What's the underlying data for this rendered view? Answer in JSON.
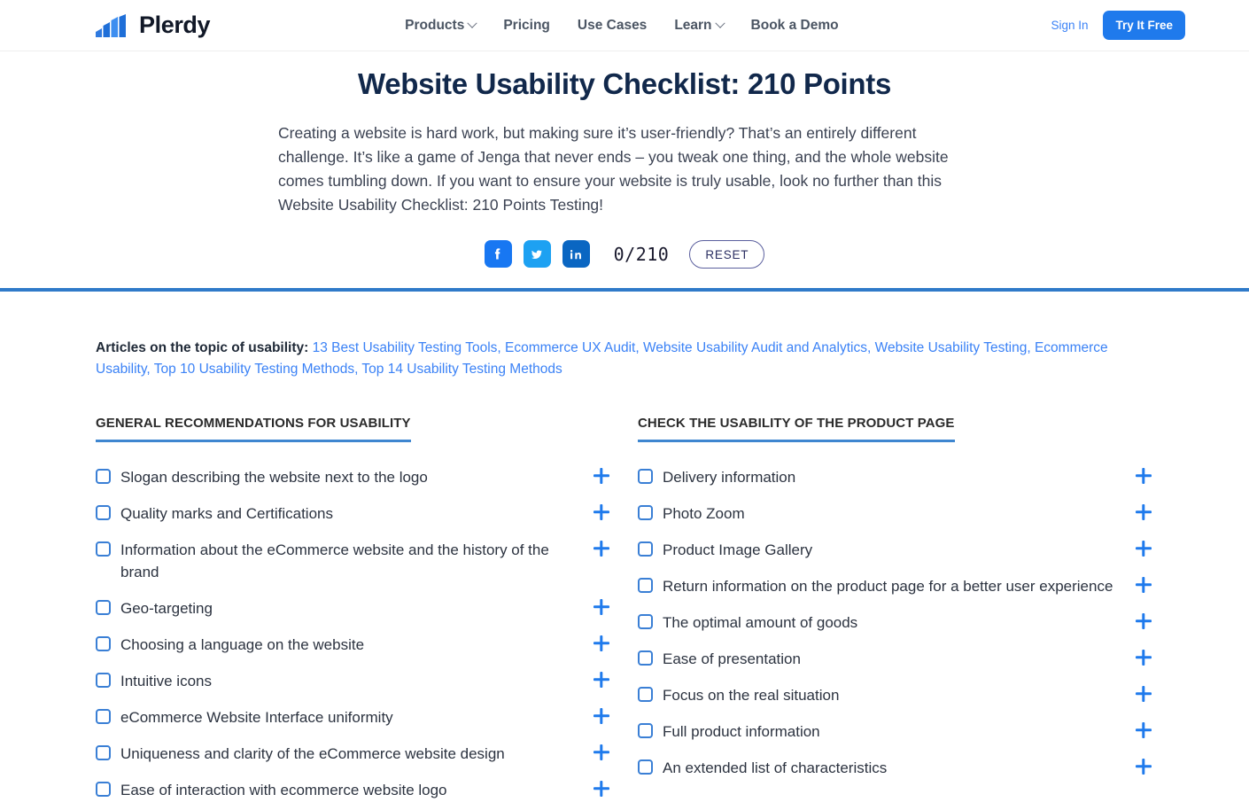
{
  "header": {
    "logo_word": "Plerdy",
    "logo_mark_icon": "bar-chart-logo-icon",
    "flag_icon": "ukraine-flag-icon",
    "nav": [
      {
        "label": "Products",
        "has_caret": true
      },
      {
        "label": "Pricing",
        "has_caret": false
      },
      {
        "label": "Use Cases",
        "has_caret": false
      },
      {
        "label": "Learn",
        "has_caret": true
      },
      {
        "label": "Book a Demo",
        "has_caret": false
      }
    ],
    "sign_in": "Sign In",
    "try_free": "Try It Free",
    "accent_color": "#1f7aec"
  },
  "hero": {
    "title": "Website Usability Checklist: 210 Points",
    "description": "Creating a website is hard work, but making sure it’s user-friendly? That’s an entirely different challenge. It’s like a game of Jenga that never ends – you tweak one thing, and the whole website comes tumbling down. If you want to ensure your website is truly usable, look no further than this Website Usability Checklist: 210 Points Testing!",
    "share": [
      {
        "name": "facebook-share-button",
        "icon": "facebook-icon",
        "color": "#1877F2"
      },
      {
        "name": "twitter-share-button",
        "icon": "twitter-icon",
        "color": "#1DA1F2"
      },
      {
        "name": "linkedin-share-button",
        "icon": "linkedin-icon",
        "color": "#0A66C2"
      }
    ],
    "counter": "0/210",
    "reset_label": "RESET",
    "divider_color": "#2f7ac9"
  },
  "articles": {
    "label": "Articles on the topic of usability:",
    "links": [
      "13 Best Usability Testing Tools",
      "Ecommerce UX Audit",
      "Website Usability Audit and Analytics",
      "Website Usability Testing",
      "Ecommerce Usability",
      "Top 10 Usability Testing Methods",
      "Top 14 Usability Testing Methods"
    ]
  },
  "columns": [
    {
      "title": "GENERAL RECOMMENDATIONS FOR USABILITY",
      "items": [
        "Slogan describing the website next to the logo",
        "Quality marks and Certifications",
        "Information about the eCommerce website and the history of the brand",
        "Geo-targeting",
        "Choosing a language on the website",
        "Intuitive icons",
        "eCommerce Website Interface uniformity",
        "Uniqueness and clarity of the eCommerce website design",
        "Ease of interaction with ecommerce website logo"
      ]
    },
    {
      "title": "CHECK THE USABILITY OF THE PRODUCT PAGE",
      "items": [
        "Delivery information",
        "Photo Zoom",
        "Product Image Gallery",
        "Return information on the product page for a better user experience",
        "The optimal amount of goods",
        "Ease of presentation",
        "Focus on the real situation",
        "Full product information",
        "An extended list of characteristics"
      ]
    }
  ]
}
